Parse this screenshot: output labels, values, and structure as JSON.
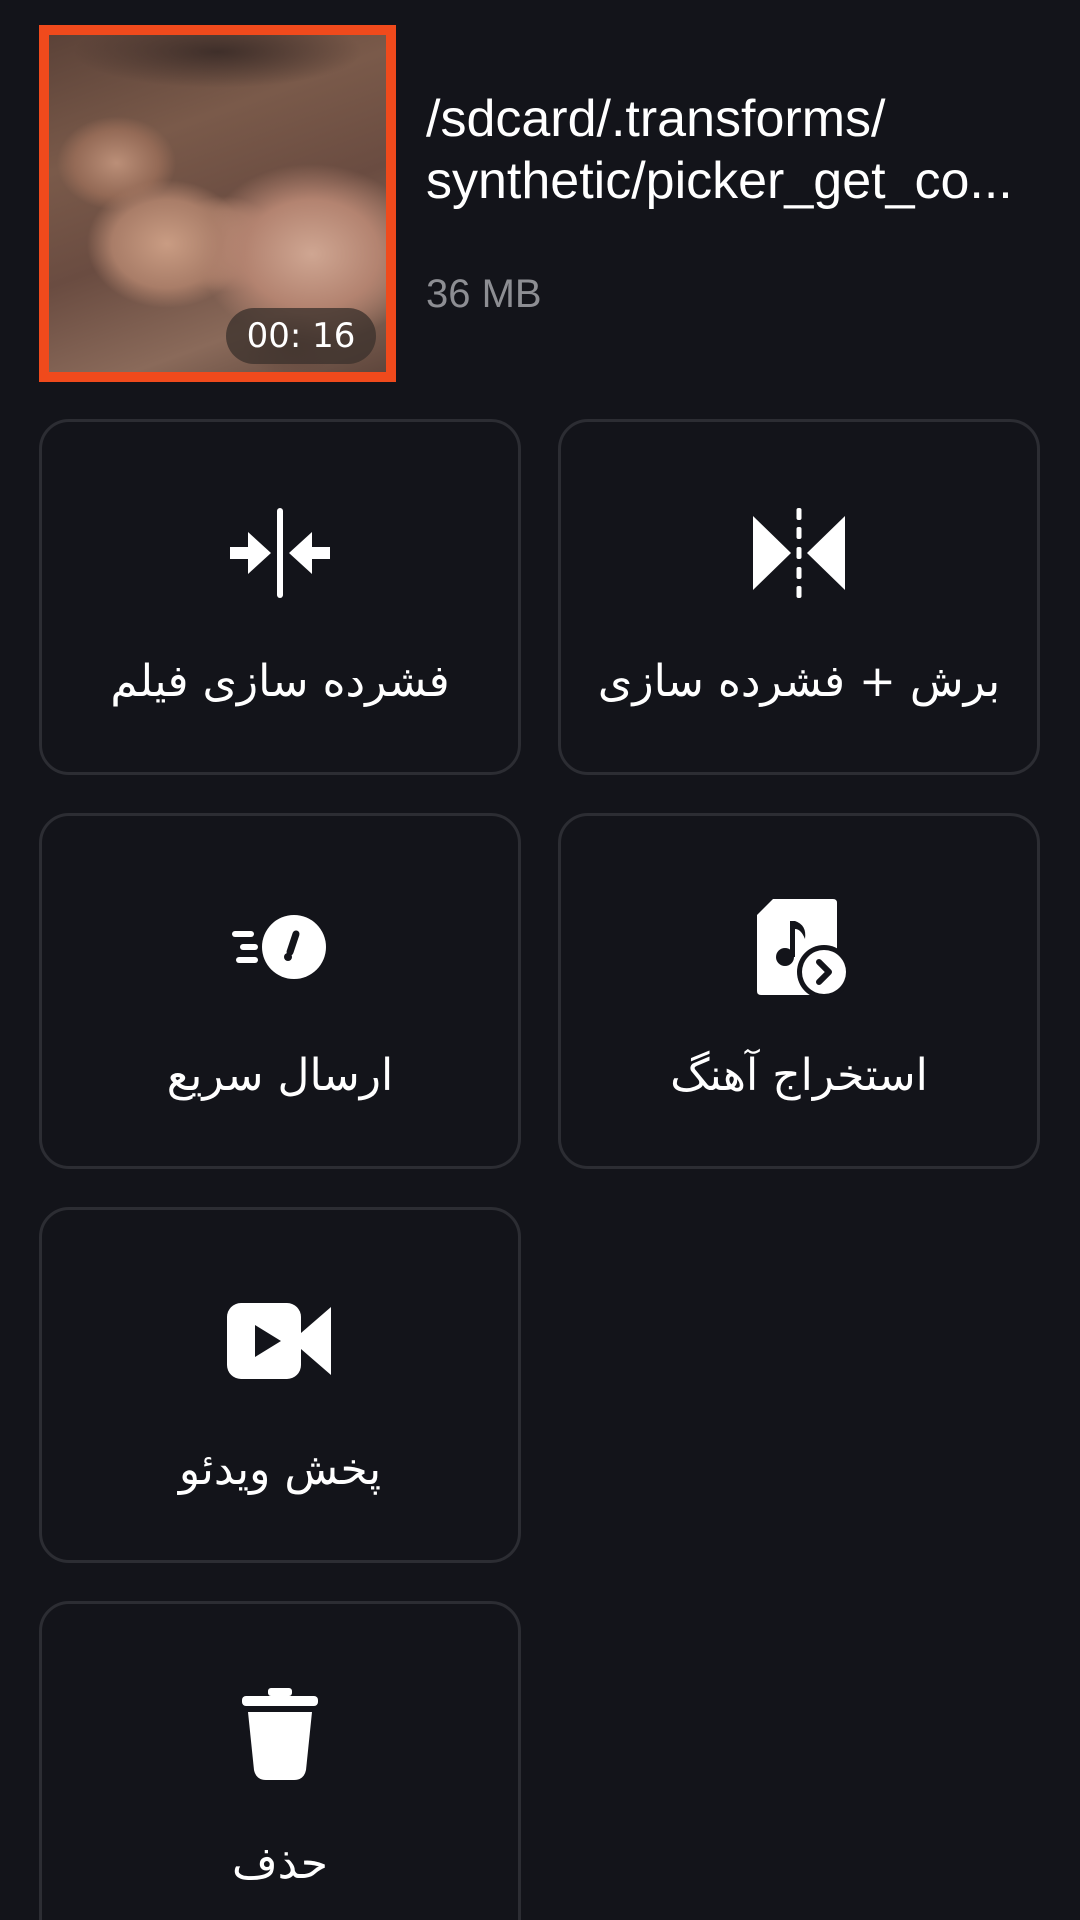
{
  "file": {
    "title_line1": "/sdcard/.transforms/",
    "title_line2": "synthetic/picker_get_co...",
    "size": "36 MB",
    "duration": "00: 16"
  },
  "actions": [
    {
      "label": "فشرده سازی فیلم",
      "icon": "compress-arrows-icon"
    },
    {
      "label": "برش + فشرده سازی",
      "icon": "trim-compress-icon"
    },
    {
      "label": "ارسال سریع",
      "icon": "fast-send-clock-icon"
    },
    {
      "label": "استخراج آهنگ",
      "icon": "extract-music-file-icon"
    },
    {
      "label": "پخش ویدئو",
      "icon": "video-camera-play-icon"
    },
    {
      "label": "حذف",
      "icon": "trash-icon"
    }
  ],
  "colors": {
    "background": "#13141a",
    "card_border": "#2c2d33",
    "thumbnail_border": "#f04a1c",
    "secondary_text": "#8d8e93"
  }
}
